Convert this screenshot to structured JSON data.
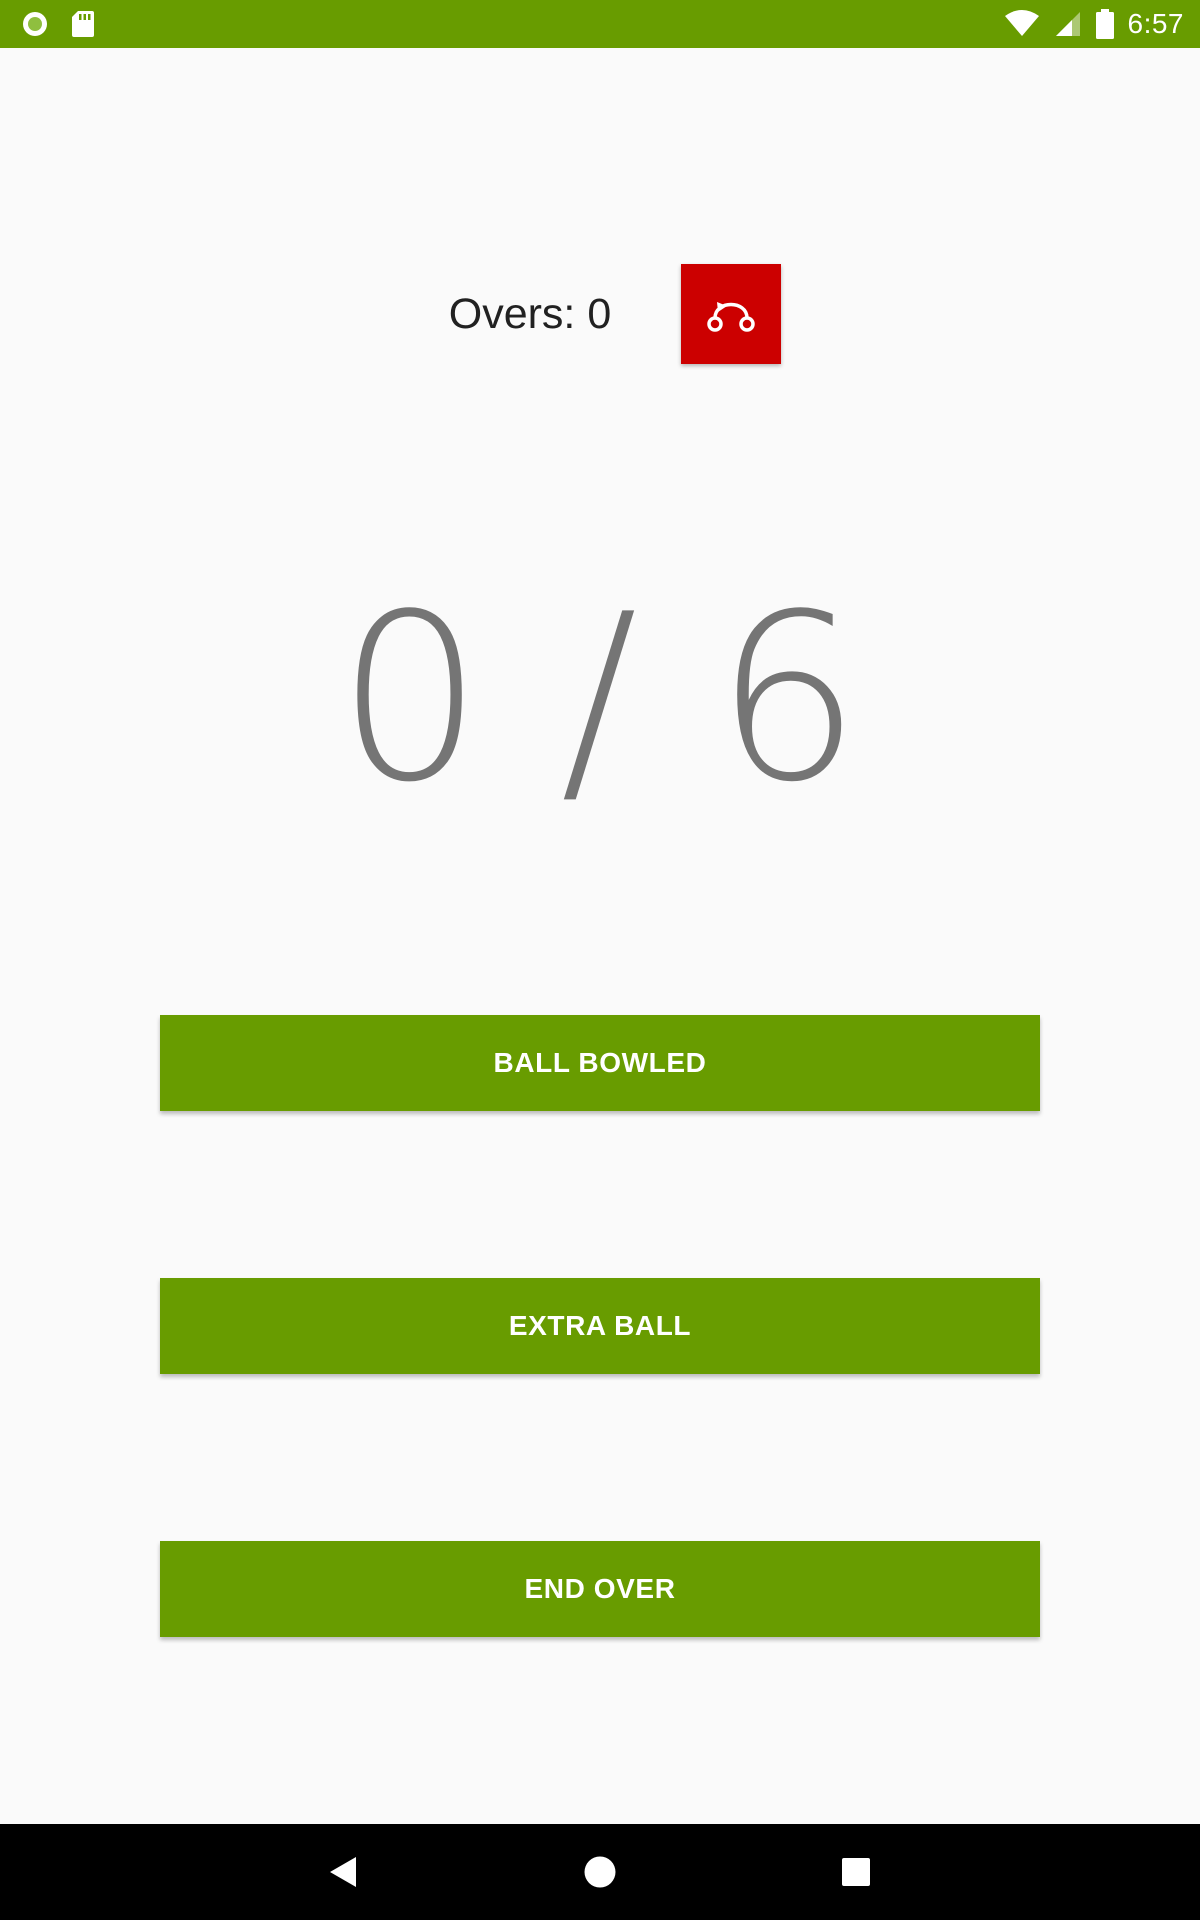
{
  "status_bar": {
    "time": "6:57",
    "icons": [
      "circle-notification-icon",
      "sd-card-icon",
      "wifi-icon",
      "cell-signal-icon",
      "battery-icon"
    ],
    "background_color": "#689c00"
  },
  "overs": {
    "label": "Overs: 0"
  },
  "reset_button": {
    "icon": "undo-icon",
    "color": "#cc0000"
  },
  "ball_counter": {
    "text": "0 / 6"
  },
  "buttons": {
    "ball_bowled": "BALL BOWLED",
    "extra_ball": "EXTRA BALL",
    "end_over": "END OVER",
    "color": "#689c00"
  },
  "nav_bar": {
    "icons": [
      "back-icon",
      "home-icon",
      "recents-icon"
    ]
  }
}
